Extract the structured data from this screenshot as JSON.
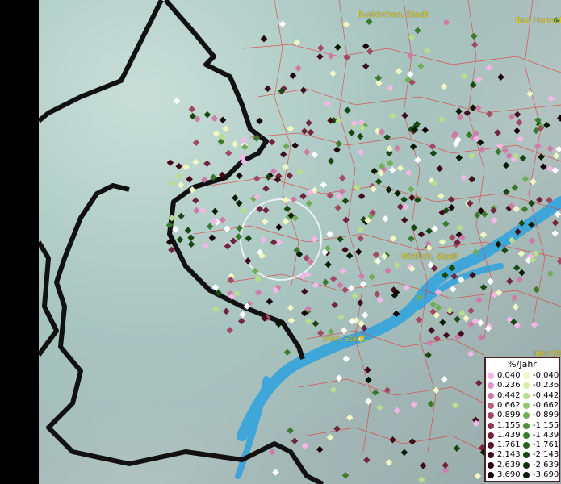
{
  "places": [
    {
      "name": "Euskirchen, Stadt"
    },
    {
      "name": "Bad Honnef"
    },
    {
      "name": "Wittlich, Stadt"
    },
    {
      "name": "Trier, Stadt"
    },
    {
      "name": "Idar-Ob"
    }
  ],
  "legend": {
    "title": "%/Jahr",
    "positive": [
      {
        "value": "0.040",
        "color": "#f6b6e6"
      },
      {
        "value": "0.236",
        "color": "#e397c8"
      },
      {
        "value": "0.442",
        "color": "#cf7ba8"
      },
      {
        "value": "0.662",
        "color": "#b9607f"
      },
      {
        "value": "0.899",
        "color": "#a24a63"
      },
      {
        "value": "1.155",
        "color": "#8a3650"
      },
      {
        "value": "1.439",
        "color": "#71243d"
      },
      {
        "value": "1.761",
        "color": "#58172b"
      },
      {
        "value": "2.143",
        "color": "#400c1b"
      },
      {
        "value": "2.639",
        "color": "#2a050f"
      },
      {
        "value": "3.690",
        "color": "#160106"
      }
    ],
    "negative": [
      {
        "value": "-0.040",
        "color": "#f0f7c3"
      },
      {
        "value": "-0.236",
        "color": "#d6eea6"
      },
      {
        "value": "-0.442",
        "color": "#b6de8b"
      },
      {
        "value": "-0.662",
        "color": "#93c86f"
      },
      {
        "value": "-0.899",
        "color": "#71ad56"
      },
      {
        "value": "-1.155",
        "color": "#52913f"
      },
      {
        "value": "-1.439",
        "color": "#3b7a2c"
      },
      {
        "value": "-1.761",
        "color": "#28611d"
      },
      {
        "value": "-2.143",
        "color": "#184812"
      },
      {
        "value": "-2.639",
        "color": "#0d3009"
      },
      {
        "value": "-3.690",
        "color": "#051a03"
      }
    ]
  }
}
